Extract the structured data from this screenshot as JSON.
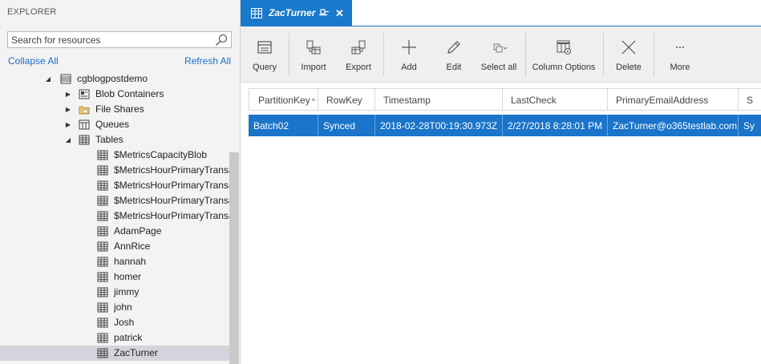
{
  "explorer": {
    "title": "EXPLORER",
    "search_placeholder": "Search for resources",
    "collapse_all": "Collapse All",
    "refresh_all": "Refresh All",
    "tree": [
      {
        "label": "cgblogpostdemo",
        "icon": "storage-account-icon",
        "expanded": true
      },
      {
        "label": "Blob Containers",
        "icon": "blob-container-icon",
        "expanded": false
      },
      {
        "label": "File Shares",
        "icon": "folder-icon",
        "expanded": false
      },
      {
        "label": "Queues",
        "icon": "queue-icon",
        "expanded": false
      },
      {
        "label": "Tables",
        "icon": "table-icon",
        "expanded": true
      },
      {
        "label": "$MetricsCapacityBlob",
        "icon": "table-icon"
      },
      {
        "label": "$MetricsHourPrimaryTransa",
        "icon": "table-icon"
      },
      {
        "label": "$MetricsHourPrimaryTransa",
        "icon": "table-icon"
      },
      {
        "label": "$MetricsHourPrimaryTransa",
        "icon": "table-icon"
      },
      {
        "label": "$MetricsHourPrimaryTransa",
        "icon": "table-icon"
      },
      {
        "label": "AdamPage",
        "icon": "table-icon"
      },
      {
        "label": "AnnRice",
        "icon": "table-icon"
      },
      {
        "label": "hannah",
        "icon": "table-icon"
      },
      {
        "label": "homer",
        "icon": "table-icon"
      },
      {
        "label": "jimmy",
        "icon": "table-icon"
      },
      {
        "label": "john",
        "icon": "table-icon"
      },
      {
        "label": "Josh",
        "icon": "table-icon"
      },
      {
        "label": "patrick",
        "icon": "table-icon"
      },
      {
        "label": "ZacTurner",
        "icon": "table-icon",
        "selected": true
      }
    ]
  },
  "tab": {
    "label": "ZacTurner"
  },
  "toolbar": {
    "query": "Query",
    "import": "Import",
    "export": "Export",
    "add": "Add",
    "edit": "Edit",
    "select_all": "Select all",
    "column_options": "Column Options",
    "delete": "Delete",
    "more": "More"
  },
  "grid": {
    "columns": [
      "PartitionKey",
      "RowKey",
      "Timestamp",
      "LastCheck",
      "PrimaryEmailAddress",
      "S"
    ],
    "rows": [
      [
        "Batch02",
        "Synced",
        "2018-02-28T00:19:30.973Z",
        "2/27/2018 8:28:01 PM",
        "ZacTurner@o365testlab.com",
        "Sy"
      ]
    ]
  },
  "colors": {
    "accent": "#1979ca",
    "selected_row": "#1a74c9",
    "link": "#1a6ec8"
  }
}
